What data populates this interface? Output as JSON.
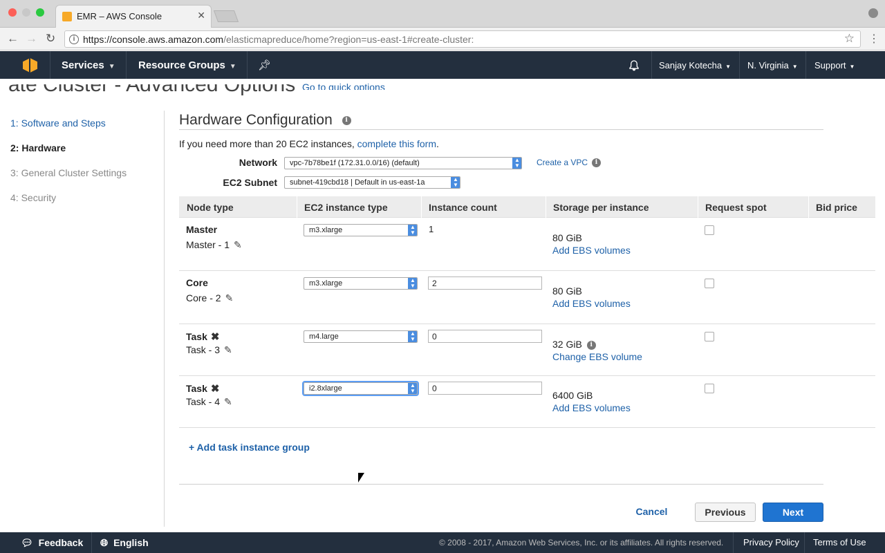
{
  "browser": {
    "tab_title": "EMR – AWS Console",
    "url_host": "https://console.aws.amazon.com",
    "url_path": "/elasticmapreduce/home?region=us-east-1#create-cluster:"
  },
  "awsnav": {
    "services": "Services",
    "resource_groups": "Resource Groups",
    "user": "Sanjay Kotecha",
    "region": "N. Virginia",
    "support": "Support"
  },
  "page": {
    "title": "ate Cluster - Advanced Options",
    "quick_link": "Go to quick options"
  },
  "sidebar": {
    "items": [
      {
        "label": "1: Software and Steps"
      },
      {
        "label": "2: Hardware"
      },
      {
        "label": "3: General Cluster Settings"
      },
      {
        "label": "4: Security"
      }
    ]
  },
  "hardware": {
    "heading": "Hardware Configuration",
    "note_prefix": "If you need more than 20 EC2 instances,",
    "note_link": "complete this form",
    "note_suffix": ".",
    "network_label": "Network",
    "network_value": "vpc-7b78be1f (172.31.0.0/16) (default)",
    "create_vpc": "Create a VPC",
    "subnet_label": "EC2 Subnet",
    "subnet_value": "subnet-419cbd18 | Default in us-east-1a"
  },
  "table": {
    "headers": [
      "Node type",
      "EC2 instance type",
      "Instance count",
      "Storage per instance",
      "Request spot",
      "Bid price"
    ],
    "rows": [
      {
        "type": "Master",
        "name": "Master - 1",
        "instance": "m3.xlarge",
        "count": "1",
        "storage": "80 GiB",
        "ebs": "Add EBS volumes"
      },
      {
        "type": "Core",
        "name": "Core - 2",
        "instance": "m3.xlarge",
        "count": "2",
        "storage": "80 GiB",
        "ebs": "Add EBS volumes"
      },
      {
        "type": "Task",
        "name": "Task - 3",
        "instance": "m4.large",
        "count": "0",
        "storage": "32 GiB",
        "ebs": "Change EBS volume"
      },
      {
        "type": "Task",
        "name": "Task - 4",
        "instance": "i2.8xlarge",
        "count": "0",
        "storage": "6400 GiB",
        "ebs": "Add EBS volumes"
      }
    ],
    "add_task": "+ Add task instance group"
  },
  "actions": {
    "cancel": "Cancel",
    "previous": "Previous",
    "next": "Next"
  },
  "footer": {
    "feedback": "Feedback",
    "language": "English",
    "copyright": "© 2008 - 2017, Amazon Web Services, Inc. or its affiliates. All rights reserved.",
    "privacy": "Privacy Policy",
    "terms": "Terms of Use"
  },
  "colors": {
    "nav_bg": "#232f3e",
    "link": "#1e61a8",
    "primary_button": "#1f74d1"
  }
}
